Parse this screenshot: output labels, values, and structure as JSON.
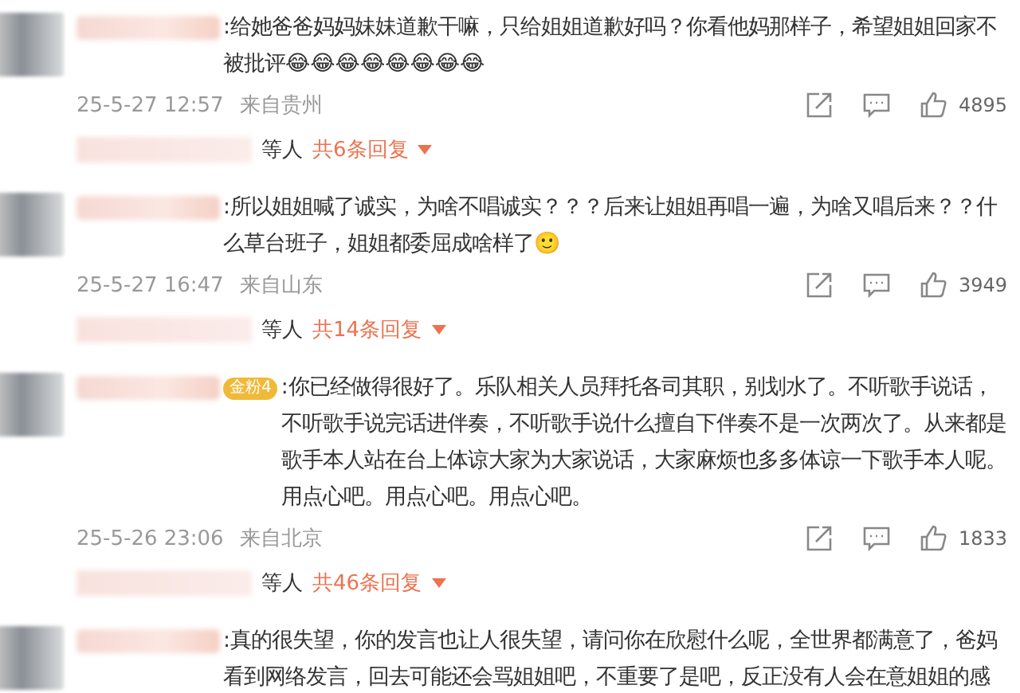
{
  "comments": [
    {
      "text": ":给她爸爸妈妈妹妹道歉干嘛，只给姐姐道歉好吗？你看他妈那样子，希望姐姐回家不被批评😂😂😂😂😂😂😂😂",
      "time": "25-5-27 12:57",
      "location": "来自贵州",
      "likes": "4895",
      "replies_suffix": "等人",
      "replies_link": "共6条回复"
    },
    {
      "text": ":所以姐姐喊了诚实，为啥不唱诚实？？？后来让姐姐再唱一遍，为啥又唱后来？？什么草台班子，姐姐都委屈成啥样了🙂",
      "time": "25-5-27 16:47",
      "location": "来自山东",
      "likes": "3949",
      "replies_suffix": "等人",
      "replies_link": "共14条回复"
    },
    {
      "badge": "金粉4",
      "text": ":你已经做得很好了。乐队相关人员拜托各司其职，别划水了。不听歌手说话，不听歌手说完话进伴奏，不听歌手说什么擅自下伴奏不是一次两次了。从来都是歌手本人站在台上体谅大家为大家说话，大家麻烦也多多体谅一下歌手本人呢。用点心吧。用点心吧。用点心吧。",
      "time": "25-5-26 23:06",
      "location": "来自北京",
      "likes": "1833",
      "replies_suffix": "等人",
      "replies_link": "共46条回复"
    },
    {
      "text": ":真的很失望，你的发言也让人很失望，请问你在欣慰什么呢，全世界都满意了，爸妈看到网络发言，回去可能还会骂姐姐吧，不重要了是吧，反正没有人会在意姐姐的感"
    }
  ]
}
